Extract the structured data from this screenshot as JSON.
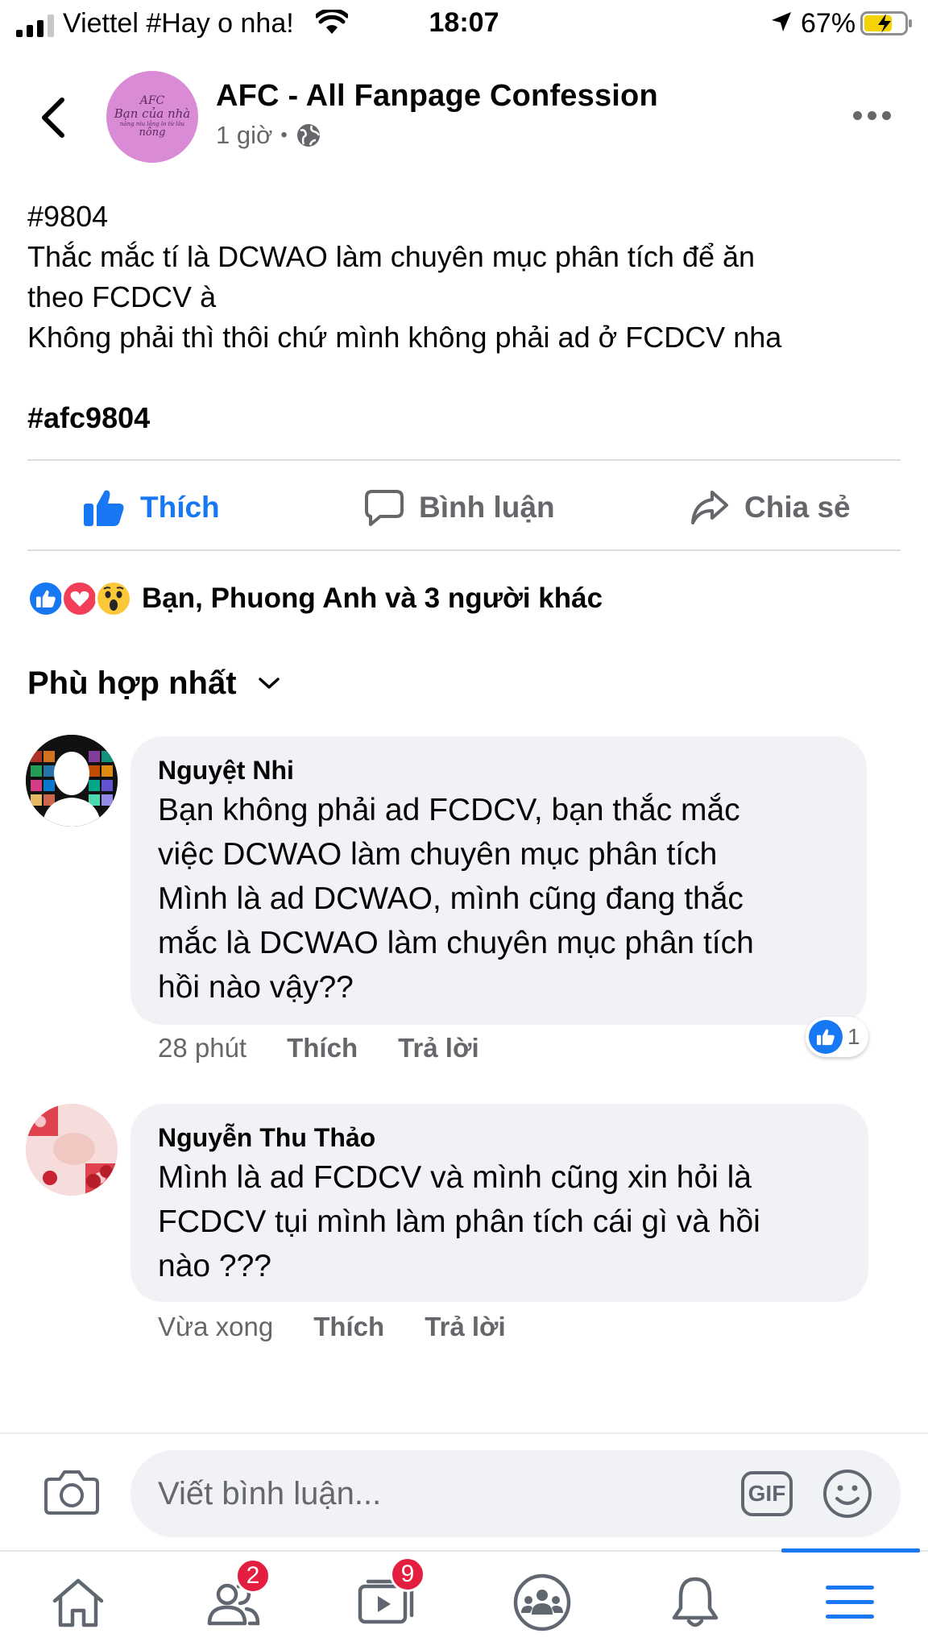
{
  "status_bar": {
    "carrier": "Viettel #Hay o nha!",
    "time": "18:07",
    "battery": "67%"
  },
  "post": {
    "page_name": "AFC - All Fanpage Confession",
    "time": "1 giờ",
    "avatar_text": [
      "AFC",
      "Bạn của nhà",
      "nâng niu lắng lo từ lâu",
      "nông"
    ],
    "lines": [
      "#9804",
      "Thắc mắc tí là DCWAO làm chuyên mục phân tích để ăn",
      "theo FCDCV à",
      "Không phải thì thôi chứ mình không phải ad ở FCDCV nha"
    ],
    "hashtag": "#afc9804"
  },
  "actions": {
    "like": "Thích",
    "comment": "Bình luận",
    "share": "Chia sẻ"
  },
  "reactions": {
    "summary": "Bạn, Phuong Anh và 3 người khác",
    "types": [
      "like-icon",
      "love-icon",
      "wow-icon"
    ]
  },
  "sort": {
    "label": "Phù hợp nhất"
  },
  "comments": [
    {
      "author": "Nguyệt Nhi",
      "lines": [
        "Bạn không phải ad FCDCV, bạn thắc mắc",
        "việc DCWAO làm chuyên mục phân tích",
        "Mình là ad DCWAO, mình cũng đang thắc",
        "mắc là DCWAO làm chuyên mục phân tích",
        "hồi nào vậy??"
      ],
      "time": "28 phút",
      "like": "Thích",
      "reply": "Trả lời",
      "like_count": "1"
    },
    {
      "author": "Nguyễn Thu Thảo",
      "lines": [
        "Mình là ad FCDCV và mình cũng xin hỏi là",
        "FCDCV tụi mình làm phân tích cái gì và hồi",
        "nào ???"
      ],
      "time": "Vừa xong",
      "like": "Thích",
      "reply": "Trả lời"
    }
  ],
  "composer": {
    "placeholder": "Viết bình luận...",
    "gif": "GIF"
  },
  "tabbar": {
    "friends_badge": "2",
    "watch_badge": "9",
    "tabs": [
      "home-icon",
      "friends-icon",
      "watch-icon",
      "groups-icon",
      "notifications-icon",
      "menu-icon"
    ],
    "active": "menu-icon"
  },
  "colors": {
    "accent": "#1877f2",
    "secondary_text": "#65676b",
    "bubble": "#f0f2f5",
    "badge": "#e41e3f"
  }
}
